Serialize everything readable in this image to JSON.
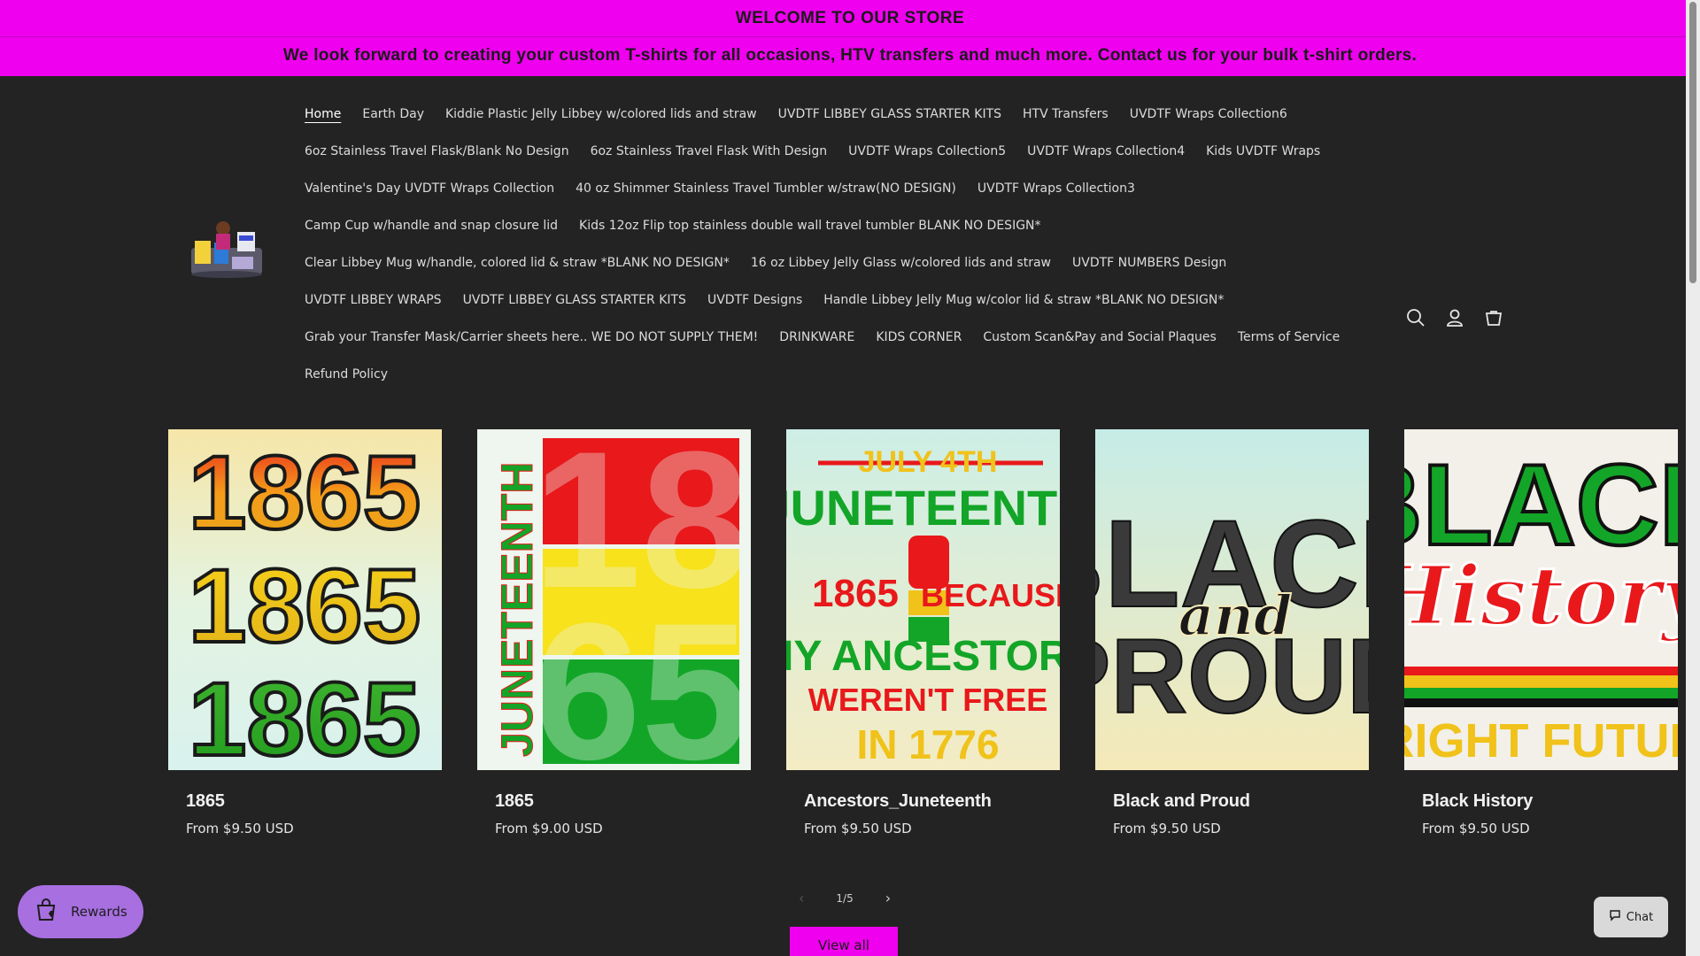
{
  "announcement": {
    "line1": "WELCOME TO OUR STORE",
    "line2": "We look forward to creating your custom T-shirts for all occasions, HTV transfers and much more. Contact us for your bulk t-shirt orders."
  },
  "nav": {
    "items": [
      "Home",
      "Earth Day",
      "Kiddie Plastic Jelly Libbey w/colored lids and straw",
      "UVDTF LIBBEY GLASS STARTER KITS",
      "HTV Transfers",
      "UVDTF Wraps Collection6",
      "6oz Stainless Travel Flask/Blank No Design",
      "6oz Stainless Travel Flask With Design",
      "UVDTF Wraps Collection5",
      "UVDTF Wraps Collection4",
      "Kids UVDTF Wraps",
      "Valentine's Day UVDTF Wraps Collection",
      "40 oz Shimmer Stainless Travel Tumbler w/straw(NO DESIGN)",
      "UVDTF Wraps Collection3",
      "Camp Cup w/handle and snap closure lid",
      "Kids 12oz Flip top stainless double wall travel tumbler BLANK NO DESIGN*",
      "Clear Libbey Mug w/handle, colored lid & straw *BLANK NO DESIGN*",
      "16 oz Libbey Jelly Glass w/colored lids and straw",
      "UVDTF NUMBERS Design",
      "UVDTF LIBBEY WRAPS",
      "UVDTF LIBBEY GLASS STARTER KITS",
      "UVDTF Designs",
      "Handle Libbey Jelly Mug w/color lid & straw *BLANK NO DESIGN*",
      "Grab your Transfer Mask/Carrier sheets here.. WE DO NOT SUPPLY THEM!",
      "DRINKWARE",
      "KIDS CORNER",
      "Custom Scan&Pay and Social Plaques",
      "Terms of Service",
      "Refund Policy"
    ]
  },
  "header_icons": [
    "search-icon",
    "account-icon",
    "cart-icon"
  ],
  "products": [
    {
      "title": "1865",
      "price": "From $9.50 USD",
      "art": {
        "top": "1865",
        "mid": "1865",
        "bot": "1865"
      }
    },
    {
      "title": "1865",
      "price": "From $9.00 USD",
      "art": {
        "side": "JUNETEENTH",
        "a": "18",
        "b": "65"
      }
    },
    {
      "title": "Ancestors_Juneteenth",
      "price": "From $9.50 USD",
      "art": {
        "l1": "JULY 4TH",
        "l2": "JUNETEENTH",
        "l3": "1865",
        "l4": "BECAUSE",
        "l5": "MY ANCESTORS",
        "l6": "WEREN'T FREE",
        "l7": "IN 1776"
      }
    },
    {
      "title": "Black and Proud",
      "price": "From $9.50 USD",
      "art": {
        "l1": "BLACK",
        "l2": "and",
        "l3": "PROUD"
      }
    },
    {
      "title": "Black History",
      "price": "From $9.50 USD",
      "art": {
        "l1": "BLACK",
        "l2": "History",
        "l3": "BRIGHT FUTURE"
      }
    }
  ],
  "pager": {
    "text": "1/5"
  },
  "view_all": "View all",
  "rewards": "Rewards",
  "chat": "Chat",
  "colors": {
    "accent": "#ef00ee",
    "background": "#232323"
  }
}
